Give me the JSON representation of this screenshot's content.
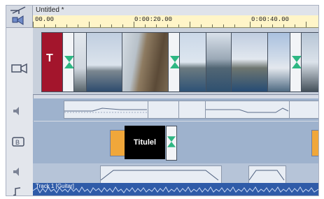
{
  "project": {
    "title": "Untitled *"
  },
  "ruler": {
    "start": "00.00",
    "mid": "0:00:20.00",
    "late": "0:00:40.00"
  },
  "title_track": {
    "clip_text": "Titulel"
  },
  "video_track": {
    "title_card_letter": "T"
  },
  "music_track": {
    "label": "Track 1 [Guitar]"
  },
  "colors": {
    "ruler_bg": "#fff5c8",
    "title_red": "#a3152c",
    "transition_green": "#2eb783",
    "music_bg": "#2f5ba8"
  },
  "icons": [
    "pointer-icon",
    "audio-speaker-icon",
    "camera-icon",
    "title-track-icon",
    "speaker-icon",
    "music-note-icon"
  ]
}
